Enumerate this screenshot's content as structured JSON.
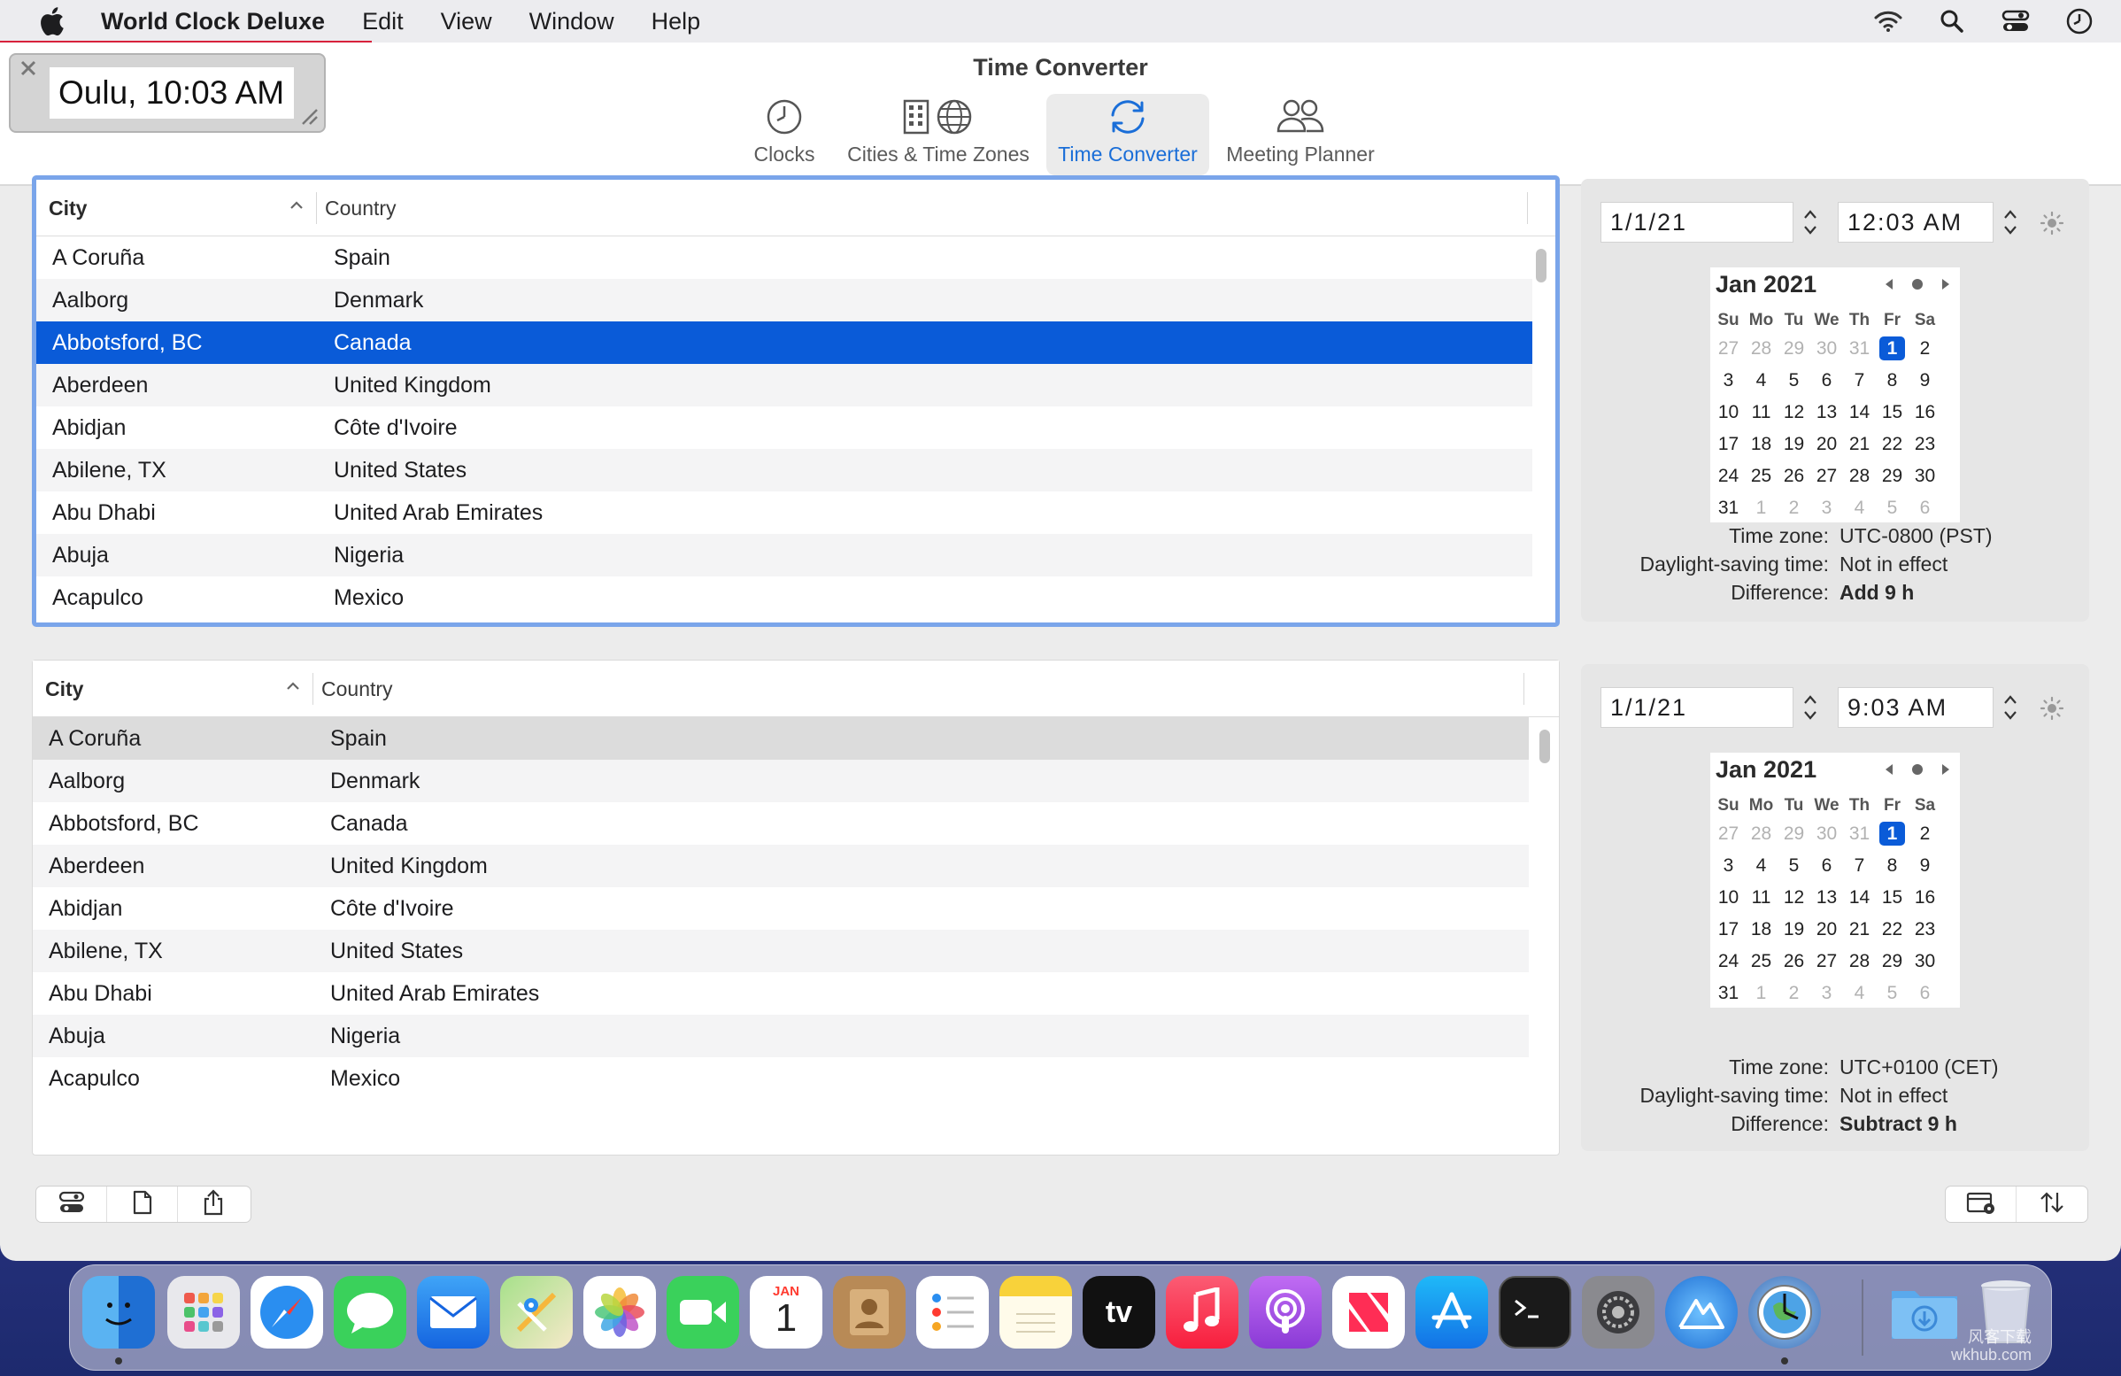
{
  "menubar": {
    "app_name": "World Clock Deluxe",
    "items": [
      "Edit",
      "View",
      "Window",
      "Help"
    ]
  },
  "window": {
    "title": "Time Converter",
    "toolbar": [
      {
        "label": "Clocks",
        "icon": "clock-icon",
        "active": false
      },
      {
        "label": "Cities & Time Zones",
        "icon": "city-globe-icon",
        "active": false
      },
      {
        "label": "Time Converter",
        "icon": "convert-arrows-icon",
        "active": true
      },
      {
        "label": "Meeting Planner",
        "icon": "people-icon",
        "active": false
      }
    ]
  },
  "mini_clock": {
    "text": "Oulu, 10:03 AM"
  },
  "table_headers": {
    "city": "City",
    "country": "Country"
  },
  "table_a": {
    "selected_index": 2,
    "rows": [
      {
        "city": "A Coruña",
        "country": "Spain"
      },
      {
        "city": "Aalborg",
        "country": "Denmark"
      },
      {
        "city": "Abbotsford, BC",
        "country": "Canada"
      },
      {
        "city": "Aberdeen",
        "country": "United Kingdom"
      },
      {
        "city": "Abidjan",
        "country": "Côte d'Ivoire"
      },
      {
        "city": "Abilene, TX",
        "country": "United States"
      },
      {
        "city": "Abu Dhabi",
        "country": "United Arab Emirates"
      },
      {
        "city": "Abuja",
        "country": "Nigeria"
      },
      {
        "city": "Acapulco",
        "country": "Mexico"
      }
    ]
  },
  "table_b": {
    "selected_index": 0,
    "rows": [
      {
        "city": "A Coruña",
        "country": "Spain"
      },
      {
        "city": "Aalborg",
        "country": "Denmark"
      },
      {
        "city": "Abbotsford, BC",
        "country": "Canada"
      },
      {
        "city": "Aberdeen",
        "country": "United Kingdom"
      },
      {
        "city": "Abidjan",
        "country": "Côte d'Ivoire"
      },
      {
        "city": "Abilene, TX",
        "country": "United States"
      },
      {
        "city": "Abu Dhabi",
        "country": "United Arab Emirates"
      },
      {
        "city": "Abuja",
        "country": "Nigeria"
      },
      {
        "city": "Acapulco",
        "country": "Mexico"
      }
    ]
  },
  "converter_a": {
    "date": "1/1/21",
    "time": "12:03  AM",
    "calendar_title": "Jan 2021",
    "labels": {
      "tz": "Time zone:",
      "dst": "Daylight-saving time:",
      "diff": "Difference:"
    },
    "time_zone": "UTC-0800 (PST)",
    "dst": "Not in effect",
    "difference": "Add 9 h"
  },
  "converter_b": {
    "date": "1/1/21",
    "time": "9:03  AM",
    "calendar_title": "Jan 2021",
    "labels": {
      "tz": "Time zone:",
      "dst": "Daylight-saving time:",
      "diff": "Difference:"
    },
    "time_zone": "UTC+0100 (CET)",
    "dst": "Not in effect",
    "difference": "Subtract 9 h"
  },
  "calendar": {
    "days_of_week": [
      "Su",
      "Mo",
      "Tu",
      "We",
      "Th",
      "Fr",
      "Sa"
    ],
    "weeks": [
      [
        "27",
        "28",
        "29",
        "30",
        "31",
        "1",
        "2"
      ],
      [
        "3",
        "4",
        "5",
        "6",
        "7",
        "8",
        "9"
      ],
      [
        "10",
        "11",
        "12",
        "13",
        "14",
        "15",
        "16"
      ],
      [
        "17",
        "18",
        "19",
        "20",
        "21",
        "22",
        "23"
      ],
      [
        "24",
        "25",
        "26",
        "27",
        "28",
        "29",
        "30"
      ],
      [
        "31",
        "1",
        "2",
        "3",
        "4",
        "5",
        "6"
      ]
    ],
    "selected_day": "1"
  },
  "dock": {
    "calendar_month": "JAN",
    "calendar_day": "1",
    "tv_label": "tv",
    "apps": [
      "finder-icon",
      "launchpad-icon",
      "safari-icon",
      "messages-icon",
      "mail-icon",
      "maps-icon",
      "photos-icon",
      "facetime-icon",
      "calendar-icon",
      "contacts-icon",
      "reminders-icon",
      "notes-icon",
      "tv-icon",
      "music-icon",
      "podcasts-icon",
      "news-icon",
      "app-store-icon",
      "terminal-icon",
      "system-preferences-icon",
      "altitude-icon",
      "world-clock-icon",
      "downloads-folder-icon",
      "trash-icon"
    ]
  },
  "watermark": {
    "line1": "风客下载",
    "line2": "wkhub.com"
  }
}
